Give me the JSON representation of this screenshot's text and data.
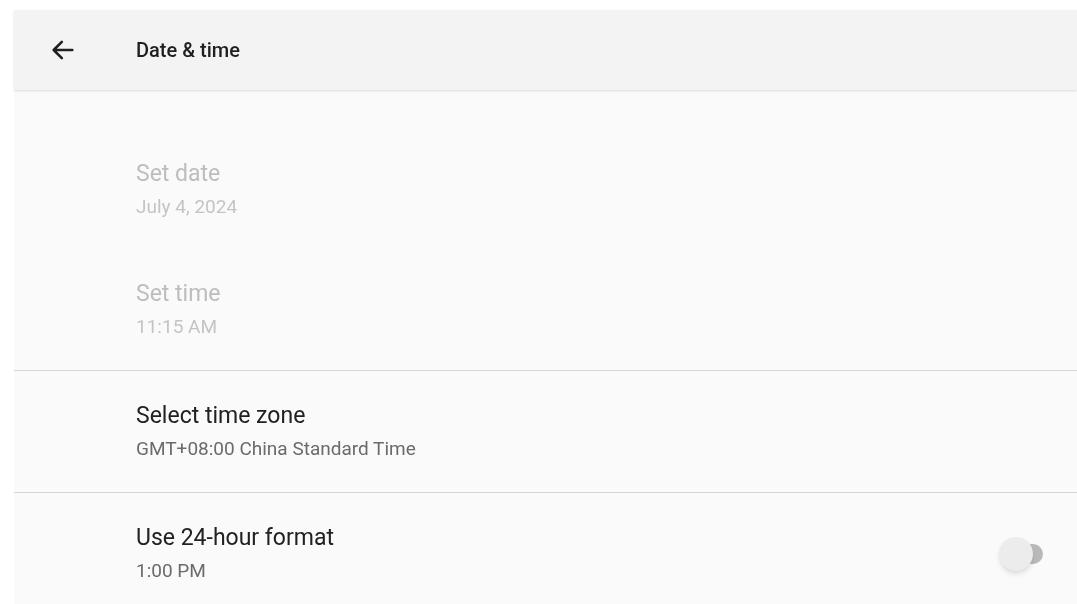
{
  "header": {
    "title": "Date & time"
  },
  "groups": [
    {
      "items": [
        {
          "title": "Set date",
          "summary": "July 4, 2024",
          "disabled": true,
          "kind": "plain"
        },
        {
          "title": "Set time",
          "summary": "11:15 AM",
          "disabled": true,
          "kind": "plain"
        }
      ]
    },
    {
      "items": [
        {
          "title": "Select time zone",
          "summary": "GMT+08:00 China Standard Time",
          "disabled": false,
          "kind": "plain"
        }
      ]
    },
    {
      "items": [
        {
          "title": "Use 24-hour format",
          "summary": "1:00 PM",
          "disabled": false,
          "kind": "switch",
          "on": false
        }
      ]
    }
  ]
}
